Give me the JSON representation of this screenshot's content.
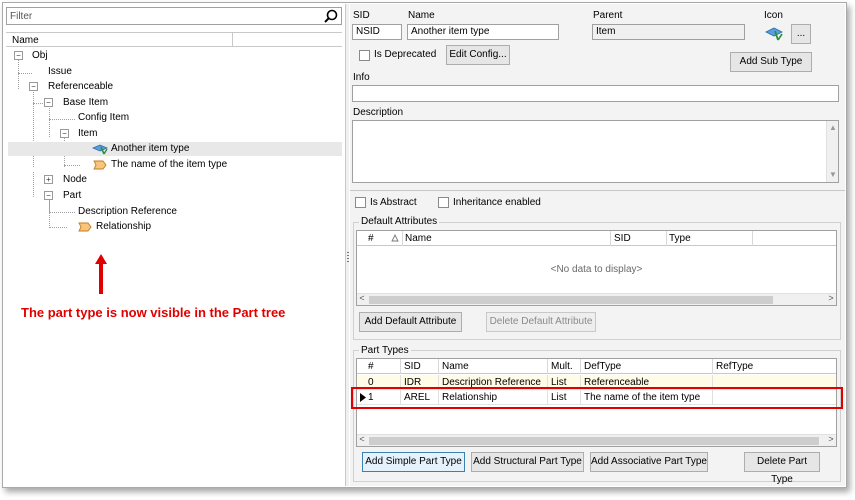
{
  "left": {
    "filter_placeholder": "Filter",
    "column_header": "Name",
    "tree": [
      {
        "label": "Obj"
      },
      {
        "label": "Issue"
      },
      {
        "label": "Referenceable"
      },
      {
        "label": "Base Item"
      },
      {
        "label": "Config Item"
      },
      {
        "label": "Item"
      },
      {
        "label": "Another item type"
      },
      {
        "label": "The name of the item type"
      },
      {
        "label": "Node"
      },
      {
        "label": "Part"
      },
      {
        "label": "Description Reference"
      },
      {
        "label": "Relationship"
      }
    ],
    "annotation": "The part type is now visible in the Part tree"
  },
  "detail": {
    "sid_label": "SID",
    "sid_value": "NSID",
    "name_label": "Name",
    "name_value": "Another item type",
    "parent_label": "Parent",
    "parent_value": "Item",
    "icon_label": "Icon",
    "icon_browse": "...",
    "is_deprecated_label": "Is Deprecated",
    "edit_config_label": "Edit Config...",
    "add_sub_type_label": "Add Sub Type",
    "info_label": "Info",
    "description_label": "Description",
    "is_abstract_label": "Is Abstract",
    "inheritance_label": "Inheritance enabled",
    "default_attributes": {
      "title": "Default Attributes",
      "columns": [
        "#",
        "Name",
        "SID",
        "Type"
      ],
      "empty_text": "<No data to display>",
      "add_label": "Add Default Attribute",
      "delete_label": "Delete Default Attribute"
    },
    "part_types": {
      "title": "Part Types",
      "columns": [
        "#",
        "SID",
        "Name",
        "Mult.",
        "DefType",
        "RefType"
      ],
      "rows": [
        {
          "num": "0",
          "sid": "IDR",
          "name": "Description Reference",
          "mult": "List",
          "deftype": "Referenceable",
          "reftype": ""
        },
        {
          "num": "1",
          "sid": "AREL",
          "name": "Relationship",
          "mult": "List",
          "deftype": "The name of the item type",
          "reftype": ""
        }
      ],
      "add_simple_label": "Add Simple Part Type",
      "add_structural_label": "Add Structural Part Type",
      "add_associative_label": "Add Associative Part Type",
      "delete_label": "Delete Part Type"
    }
  },
  "colors": {
    "annotation_red": "#e00000",
    "row_highlight": "#fffbe6"
  },
  "icons": [
    "search-icon",
    "tree-expander-icon",
    "item-type-icon",
    "part-type-icon",
    "red-arrow-icon",
    "sort-triangle-icon",
    "row-indicator-icon"
  ]
}
